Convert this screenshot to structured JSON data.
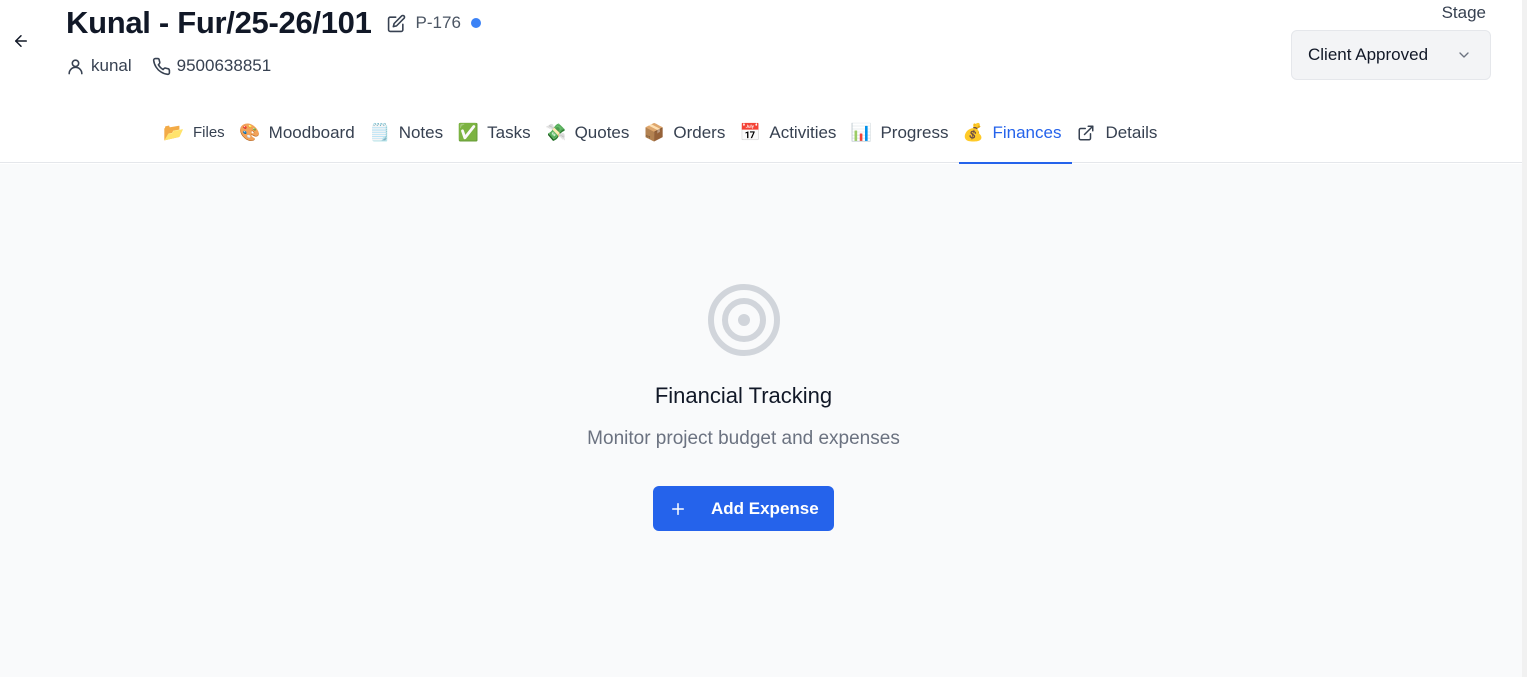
{
  "header": {
    "title": "Kunal - Fur/25-26/101",
    "code": "P-176",
    "client_name": "kunal",
    "phone": "9500638851",
    "stage_label": "Stage",
    "stage_value": "Client Approved"
  },
  "tabs": [
    {
      "label": "Files",
      "icon": "📂"
    },
    {
      "label": "Moodboard",
      "icon": "🎨"
    },
    {
      "label": "Notes",
      "icon": "🗒️"
    },
    {
      "label": "Tasks",
      "icon": "✅"
    },
    {
      "label": "Quotes",
      "icon": "💸"
    },
    {
      "label": "Orders",
      "icon": "📦"
    },
    {
      "label": "Activities",
      "icon": "📅"
    },
    {
      "label": "Progress",
      "icon": "📊"
    },
    {
      "label": "Finances",
      "icon": "💰"
    },
    {
      "label": "Details",
      "icon": "external-link-icon"
    }
  ],
  "empty_state": {
    "title": "Financial Tracking",
    "subtitle": "Monitor project budget and expenses",
    "button_label": "Add Expense"
  },
  "colors": {
    "accent": "#2563eb",
    "status_dot": "#3b82f6",
    "background": "#f9fafb"
  }
}
